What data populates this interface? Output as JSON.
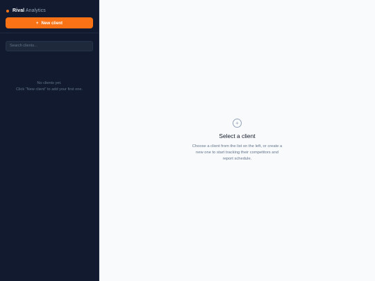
{
  "brand": {
    "strong": "Rival",
    "rest": " Analytics"
  },
  "sidebar": {
    "new_client_plus": "+",
    "new_client_label": "New client",
    "search_placeholder": "Search clients...",
    "empty_line1": "No clients yet.",
    "empty_line2": "Click \"New client\" to add your first one."
  },
  "main": {
    "add_icon": "+",
    "title": "Select a client",
    "description": "Choose a client from the list on the left, or create a new one to start tracking their competitors and report schedule."
  },
  "colors": {
    "sidebar_bg": "#111a2e",
    "accent": "#f97316",
    "main_bg": "#f8fafc"
  }
}
